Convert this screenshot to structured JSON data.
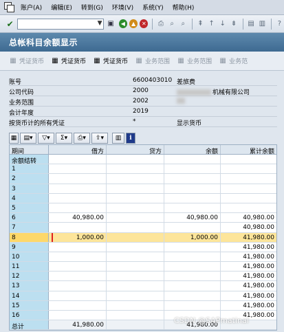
{
  "menubar": {
    "items": [
      "账户(A)",
      "编辑(E)",
      "转到(G)",
      "环境(V)",
      "系统(Y)",
      "帮助(H)"
    ]
  },
  "toolbar": {
    "command_value": ""
  },
  "title": "总帐科目余额显示",
  "app_toolbar": {
    "buttons": [
      {
        "label": "凭证货币",
        "enabled": false
      },
      {
        "label": "凭证货币",
        "enabled": true
      },
      {
        "label": "凭证货币",
        "enabled": true
      },
      {
        "label": "业务范围",
        "enabled": false
      },
      {
        "label": "业务范围",
        "enabled": false
      },
      {
        "label": "业务范",
        "enabled": false
      }
    ]
  },
  "header": {
    "rows": [
      {
        "label": "账号",
        "value": "6600403010",
        "desc": "差旅费"
      },
      {
        "label": "公司代码",
        "value": "2000",
        "desc": "机械有限公司"
      },
      {
        "label": "业务范围",
        "value": "2002",
        "desc": ""
      },
      {
        "label": "会计年度",
        "value": "2019",
        "desc": ""
      },
      {
        "label": "按货币计的所有凭证",
        "value": "*",
        "desc": "显示货币"
      }
    ]
  },
  "grid": {
    "columns": [
      "期间",
      "借方",
      "贷方",
      "余额",
      "累计余额"
    ],
    "rows": [
      {
        "period": "余额结转",
        "debit": "",
        "credit": "",
        "balance": "",
        "cumulative": ""
      },
      {
        "period": "1",
        "debit": "",
        "credit": "",
        "balance": "",
        "cumulative": ""
      },
      {
        "period": "2",
        "debit": "",
        "credit": "",
        "balance": "",
        "cumulative": ""
      },
      {
        "period": "3",
        "debit": "",
        "credit": "",
        "balance": "",
        "cumulative": ""
      },
      {
        "period": "4",
        "debit": "",
        "credit": "",
        "balance": "",
        "cumulative": ""
      },
      {
        "period": "5",
        "debit": "",
        "credit": "",
        "balance": "",
        "cumulative": ""
      },
      {
        "period": "6",
        "debit": "40,980.00",
        "credit": "",
        "balance": "40,980.00",
        "cumulative": "40,980.00"
      },
      {
        "period": "7",
        "debit": "",
        "credit": "",
        "balance": "",
        "cumulative": "40,980.00"
      },
      {
        "period": "8",
        "debit": "1,000.00",
        "credit": "",
        "balance": "1,000.00",
        "cumulative": "41,980.00"
      },
      {
        "period": "9",
        "debit": "",
        "credit": "",
        "balance": "",
        "cumulative": "41,980.00"
      },
      {
        "period": "10",
        "debit": "",
        "credit": "",
        "balance": "",
        "cumulative": "41,980.00"
      },
      {
        "period": "11",
        "debit": "",
        "credit": "",
        "balance": "",
        "cumulative": "41,980.00"
      },
      {
        "period": "12",
        "debit": "",
        "credit": "",
        "balance": "",
        "cumulative": "41,980.00"
      },
      {
        "period": "13",
        "debit": "",
        "credit": "",
        "balance": "",
        "cumulative": "41,980.00"
      },
      {
        "period": "14",
        "debit": "",
        "credit": "",
        "balance": "",
        "cumulative": "41,980.00"
      },
      {
        "period": "15",
        "debit": "",
        "credit": "",
        "balance": "",
        "cumulative": "41,980.00"
      },
      {
        "period": "16",
        "debit": "",
        "credit": "",
        "balance": "",
        "cumulative": "41,980.00"
      },
      {
        "period": "总计",
        "debit": "41,980.00",
        "credit": "",
        "balance": "41,980.00",
        "cumulative": ""
      }
    ]
  },
  "watermark": "CSDN @SAPmatinal",
  "colors": {
    "title_bar": "#4a769c",
    "selected_row": "#fde59a",
    "period_column": "#bcdff0",
    "highlight_box": "#e02020"
  }
}
